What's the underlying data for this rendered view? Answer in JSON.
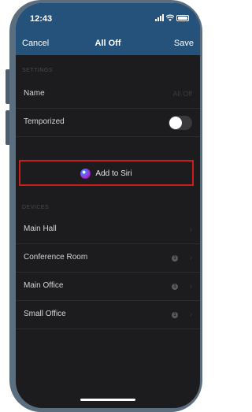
{
  "status": {
    "time": "12:43"
  },
  "nav": {
    "cancel": "Cancel",
    "title": "All Off",
    "save": "Save"
  },
  "settings": {
    "header": "SETTINGS",
    "name_label": "Name",
    "name_value": "All Off",
    "temporized_label": "Temporized",
    "temporized_on": false
  },
  "siri": {
    "label": "Add to Siri"
  },
  "devices": {
    "header": "DEVICES",
    "items": [
      {
        "label": "Main Hall",
        "badge": ""
      },
      {
        "label": "Conference Room",
        "badge": "1"
      },
      {
        "label": "Main Office",
        "badge": "1"
      },
      {
        "label": "Small Office",
        "badge": "1"
      }
    ]
  },
  "colors": {
    "nav_bar": "#25527a",
    "background": "#1c1c1e",
    "highlight_border": "#cc1d1d"
  },
  "icons": {
    "siri": "siri-orb-icon",
    "chevron": "chevron-right-icon"
  }
}
